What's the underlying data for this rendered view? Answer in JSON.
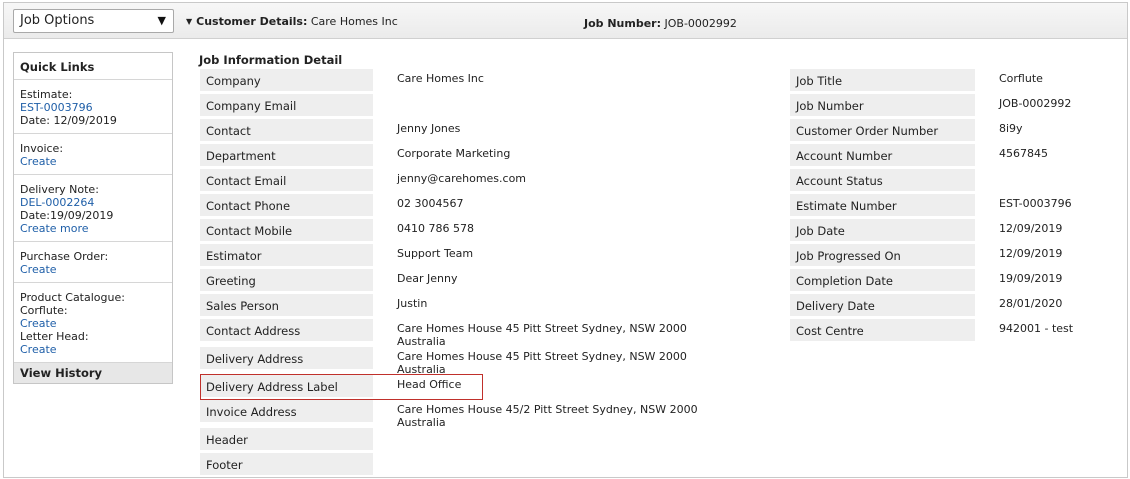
{
  "toolbar": {
    "job_options_label": "Job Options",
    "customer_details_label": "Customer Details:",
    "customer_details_value": "Care Homes Inc",
    "job_number_label": "Job Number:",
    "job_number_value": "JOB-0002992"
  },
  "quick_links": {
    "title": "Quick Links",
    "estimate_label": "Estimate:",
    "estimate_link": "EST-0003796",
    "estimate_date": "Date: 12/09/2019",
    "invoice_label": "Invoice:",
    "invoice_create": "Create",
    "delivery_label": "Delivery Note:",
    "delivery_link": "DEL-0002264",
    "delivery_date": "Date:19/09/2019",
    "delivery_create_more": "Create more",
    "po_label": "Purchase Order:",
    "po_create": "Create",
    "catalogue_label": "Product Catalogue:",
    "catalogue_item1": "Corflute:",
    "catalogue_item1_create": "Create",
    "catalogue_item2": "Letter Head:",
    "catalogue_item2_create": "Create",
    "view_history": "View History"
  },
  "section_title": "Job Information Detail",
  "left_fields": [
    {
      "label": "Company",
      "value": "Care Homes Inc"
    },
    {
      "label": "Company Email",
      "value": ""
    },
    {
      "label": "Contact",
      "value": "Jenny Jones"
    },
    {
      "label": "Department",
      "value": "Corporate Marketing"
    },
    {
      "label": "Contact Email",
      "value": "jenny@carehomes.com"
    },
    {
      "label": "Contact Phone",
      "value": "02 3004567"
    },
    {
      "label": "Contact Mobile",
      "value": "0410 786 578"
    },
    {
      "label": "Estimator",
      "value": "Support Team"
    },
    {
      "label": "Greeting",
      "value": "Dear Jenny"
    },
    {
      "label": "Sales Person",
      "value": "Justin"
    },
    {
      "label": "Contact Address",
      "value": "Care Homes House 45 Pitt Street Sydney, NSW 2000",
      "value2": "Australia"
    },
    {
      "label": "Delivery Address",
      "value": "Care Homes House 45 Pitt Street Sydney, NSW 2000",
      "value2": "Australia"
    },
    {
      "label": "Delivery Address Label",
      "value": "Head Office"
    },
    {
      "label": "Invoice Address",
      "value": "Care Homes House 45/2 Pitt Street Sydney, NSW 2000",
      "value2": "Australia"
    },
    {
      "label": "Header",
      "value": ""
    },
    {
      "label": "Footer",
      "value": ""
    }
  ],
  "right_fields": [
    {
      "label": "Job Title",
      "value": "Corflute"
    },
    {
      "label": "Job Number",
      "value": "JOB-0002992"
    },
    {
      "label": "Customer Order Number",
      "value": "8i9y"
    },
    {
      "label": "Account Number",
      "value": "4567845"
    },
    {
      "label": "Account Status",
      "value": ""
    },
    {
      "label": "Estimate Number",
      "value": "EST-0003796"
    },
    {
      "label": "Job Date",
      "value": "12/09/2019"
    },
    {
      "label": "Job Progressed On",
      "value": "12/09/2019"
    },
    {
      "label": "Completion Date",
      "value": "19/09/2019"
    },
    {
      "label": "Delivery Date",
      "value": "28/01/2020"
    },
    {
      "label": "Cost Centre",
      "value": "942001 - test"
    }
  ]
}
